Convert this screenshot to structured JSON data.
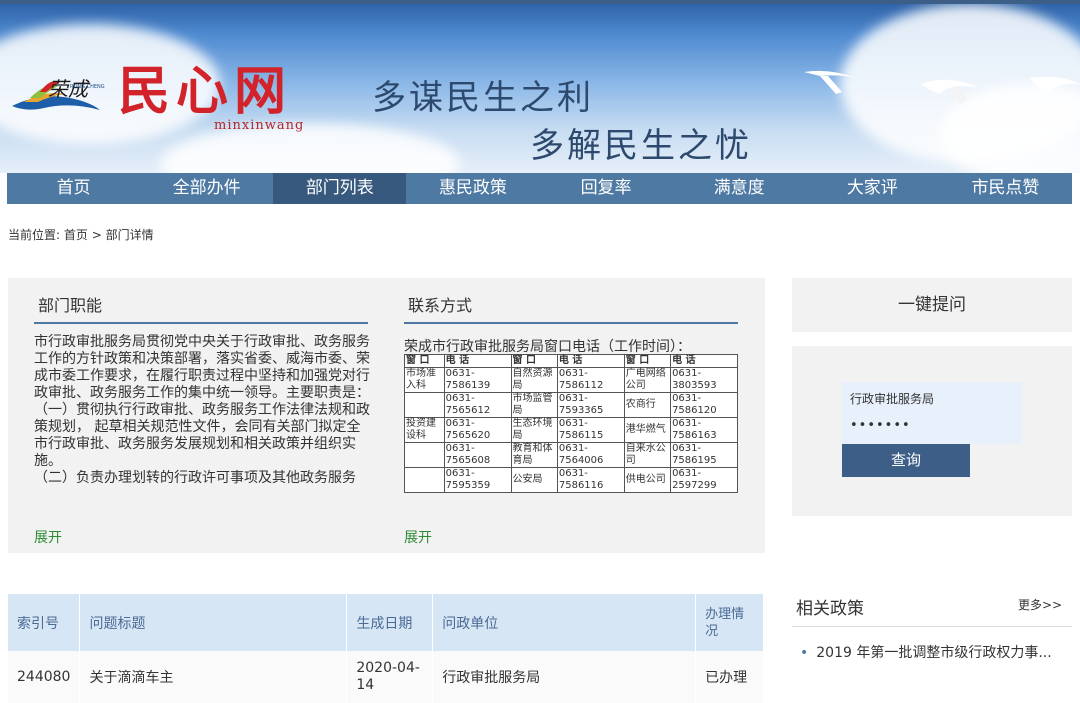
{
  "banner": {
    "logo_cn": "民心网",
    "logo_en": "minxinwang",
    "rong_cheng_en": "RONG CHENG",
    "slogan_line1": "多谋民生之利",
    "slogan_line2": "多解民生之忧"
  },
  "nav": {
    "items": [
      {
        "label": "首页"
      },
      {
        "label": "全部办件"
      },
      {
        "label": "部门列表"
      },
      {
        "label": "惠民政策"
      },
      {
        "label": "回复率"
      },
      {
        "label": "满意度"
      },
      {
        "label": "大家评"
      },
      {
        "label": "市民点赞"
      }
    ],
    "active_index": 2
  },
  "breadcrumb": {
    "prefix": "当前位置:",
    "home": "首页",
    "sep": ">",
    "current": "部门详情"
  },
  "duty": {
    "title": "部门职能",
    "text": "市行政审批服务局贯彻党中央关于行政审批、政务服务工作的方针政策和决策部署，落实省委、威海市委、荣成市委工作要求，在履行职责过程中坚持和加强党对行政审批、政务服务工作的集中统一领导。主要职责是：\n（一）贯彻执行行政审批、政务服务工作法律法规和政策规划， 起草相关规范性文件，会同有关部门拟定全市行政审批、政务服务发展规划和相关政策并组织实施。\n（二）负责办理划转的行政许可事项及其他政务服务",
    "expand_label": "展开"
  },
  "contact": {
    "title": "联系方式",
    "subtitle": "荣成市行政审批服务局窗口电话（工作时间）：",
    "headers": [
      "窗 口",
      "电 话",
      "窗 口",
      "电 话",
      "窗 口",
      "电 话"
    ],
    "rows": [
      [
        "市场准入科",
        "0631-7586139",
        "自然资源局",
        "0631-7586112",
        "广电网络公司",
        "0631-3803593"
      ],
      [
        "",
        "0631-7565612",
        "市场监管局",
        "0631-7593365",
        "农商行",
        "0631-7586120"
      ],
      [
        "投资建设科",
        "0631-7565620",
        "生态环境局",
        "0631-7586115",
        "港华燃气",
        "0631-7586163"
      ],
      [
        "",
        "0631-7565608",
        "教育和体育局",
        "0631-7564006",
        "自来水公司",
        "0631-7586195"
      ],
      [
        "",
        "0631-7595359",
        "公安局",
        "0631-7586116",
        "供电公司",
        "0631-2597299"
      ]
    ],
    "expand_label": "展开"
  },
  "ask": {
    "button_label": "一键提问"
  },
  "query": {
    "dept_value": "行政审批服务局",
    "password_mask": "•••••••",
    "button_label": "查询"
  },
  "questions": {
    "headers": [
      "索引号",
      "问题标题",
      "生成日期",
      "问政单位",
      "办理情况"
    ],
    "rows": [
      {
        "id": "244080",
        "title": "关于滴滴车主",
        "date": "2020-04-14",
        "unit": "行政审批服务局",
        "status": "已办理"
      }
    ]
  },
  "policy": {
    "title": "相关政策",
    "more_label": "更多>>",
    "items": [
      {
        "label": "2019 年第一批调整市级行政权力事..."
      }
    ]
  },
  "colors": {
    "nav_bg": "#4e79a3",
    "nav_active": "#36597d",
    "brand_red": "#d2232a",
    "status_green": "#2e8b34",
    "table_header_bg": "#d7e6f5"
  }
}
